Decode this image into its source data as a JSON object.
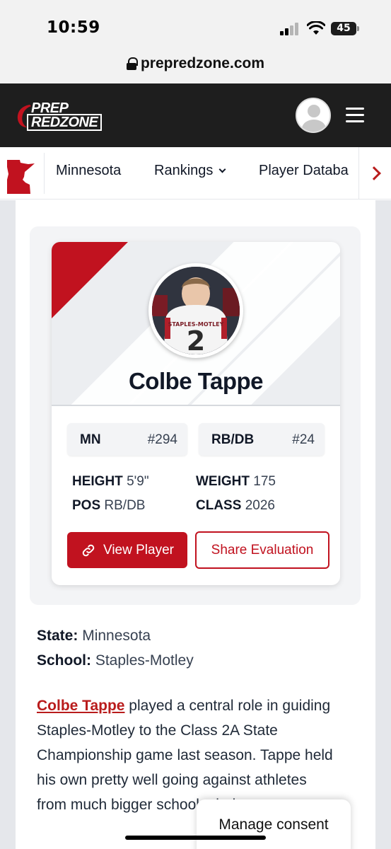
{
  "status_bar": {
    "time": "10:59",
    "battery": "45"
  },
  "browser": {
    "url": "prepredzone.com"
  },
  "site": {
    "logo_line1": "PREP",
    "logo_line2": "REDZONE"
  },
  "state_nav": {
    "items": [
      {
        "label": "Minnesota"
      },
      {
        "label": "Rankings"
      },
      {
        "label": "Player Databa"
      }
    ]
  },
  "player_card": {
    "name": "Colbe Tappe",
    "state_abbr": "MN",
    "state_rank": "#294",
    "position_label": "RB/DB",
    "position_rank": "#24",
    "height_label": "HEIGHT",
    "height_value": "5'9\"",
    "weight_label": "WEIGHT",
    "weight_value": "175",
    "pos_label": "POS",
    "pos_value": "RB/DB",
    "class_label": "CLASS",
    "class_value": "2026",
    "view_player_label": "View Player",
    "share_label": "Share Evaluation",
    "jersey_number": "2",
    "jersey_text": "STAPLES-MOTLEY"
  },
  "info": {
    "state_label": "State:",
    "state_value": "Minnesota",
    "school_label": "School:",
    "school_value": "Staples-Motley"
  },
  "article": {
    "link_text": "Colbe Tappe",
    "text": "played a central role in guiding Staples-Motley to the Class 2A State Championship game last season. Tappe held his own pretty well going against athletes from much bigger schools during"
  },
  "consent": {
    "label": "Manage consent"
  },
  "colors": {
    "brand_red": "#c1121f",
    "header_dark": "#1e1e1e"
  }
}
